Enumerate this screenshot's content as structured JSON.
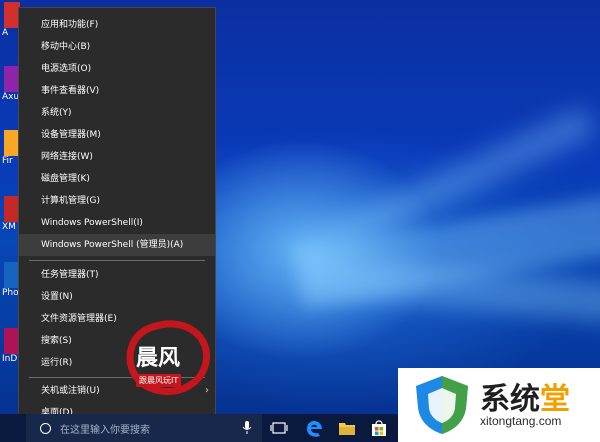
{
  "desktop": {
    "icons": [
      {
        "label": "A",
        "color": "#d32f2f"
      },
      {
        "label": "Axu",
        "color": "#8e24aa"
      },
      {
        "label": "Fir",
        "color": "#f9a825"
      },
      {
        "label": "XM",
        "color": "#c62828"
      },
      {
        "label": "Pho",
        "color": "#1565c0"
      },
      {
        "label": "InD",
        "color": "#ad1457"
      }
    ]
  },
  "menu": {
    "items": [
      {
        "label": "应用和功能(F)"
      },
      {
        "label": "移动中心(B)"
      },
      {
        "label": "电源选项(O)"
      },
      {
        "label": "事件查看器(V)"
      },
      {
        "label": "系统(Y)"
      },
      {
        "label": "设备管理器(M)"
      },
      {
        "label": "网络连接(W)"
      },
      {
        "label": "磁盘管理(K)"
      },
      {
        "label": "计算机管理(G)"
      },
      {
        "label": "Windows PowerShell(I)"
      },
      {
        "label": "Windows PowerShell (管理员)(A)"
      },
      {
        "label": "任务管理器(T)"
      },
      {
        "label": "设置(N)"
      },
      {
        "label": "文件资源管理器(E)"
      },
      {
        "label": "搜索(S)"
      },
      {
        "label": "运行(R)"
      },
      {
        "label": "关机或注销(U)"
      },
      {
        "label": "桌面(D)"
      }
    ]
  },
  "taskbar": {
    "search_placeholder": "在这里输入你要搜索",
    "icons": [
      "search-circle-icon",
      "microphone-icon",
      "task-view-icon",
      "edge-icon",
      "file-explorer-icon",
      "store-icon"
    ]
  },
  "watermark": {
    "title": "晨风",
    "subtitle": "跟晨风玩IT"
  },
  "brand": {
    "name_part1": "系统",
    "name_part2": "堂",
    "url": "xitongtang.com"
  },
  "colors": {
    "menu_bg": "#2b2b2b",
    "menu_selected": "#3d3d3d",
    "taskbar": "#0a1a3e",
    "desktop_blue": "#0a3ab8"
  }
}
